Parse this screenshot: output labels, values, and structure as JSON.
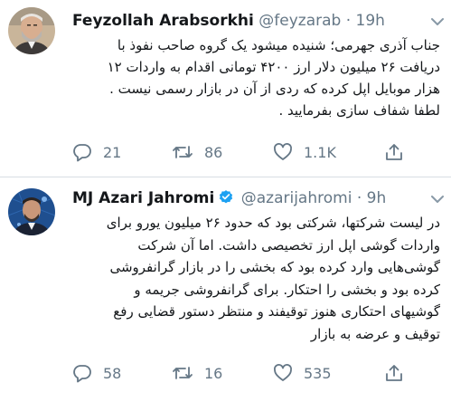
{
  "colors": {
    "text": "#14171a",
    "secondary": "#657786",
    "verified": "#1da1f2",
    "divider": "#d8dee3"
  },
  "tweets": [
    {
      "name": "Feyzollah Arabsorkhi",
      "handle": "@feyzarab",
      "separator": "·",
      "time": "19h",
      "verified": false,
      "avatar": "profile-photo-man-with-grey-beard",
      "lines": [
        "جناب آذری جهرمی؛ شنیده میشود یک گروه صاحب نفوذ با",
        "دریافت ۲۶ میلیون دلار ارز ۴۲۰۰ تومانی اقدام به واردات ۱۲",
        "هزار موبایل اپل کرده که ردی از آن در بازار رسمی نیست .",
        "لطفا شفاف سازی بفرمایید ."
      ],
      "replies": "21",
      "retweets": "86",
      "likes": "1.1K"
    },
    {
      "name": "MJ Azari Jahromi",
      "handle": "@azarijahromi",
      "separator": "·",
      "time": "9h",
      "verified": true,
      "avatar": "profile-photo-man-in-suit-blue-background",
      "lines": [
        "در لیست شرکتها، شرکتی بود که حدود ۲۶ میلیون یورو برای",
        "واردات گوشی اپل ارز تخصیصی داشت. اما آن شرکت",
        "گوشی‌هایی وارد کرده بود که بخشی را در بازار گرانفروشی",
        "کرده بود و بخشی را احتکار. برای گرانفروشی جریمه و",
        "گوشیهای احتکاری هنوز توقیفند و منتظر دستور قضایی رفع",
        "توقیف و عرضه به بازار"
      ],
      "replies": "58",
      "retweets": "16",
      "likes": "535"
    }
  ]
}
